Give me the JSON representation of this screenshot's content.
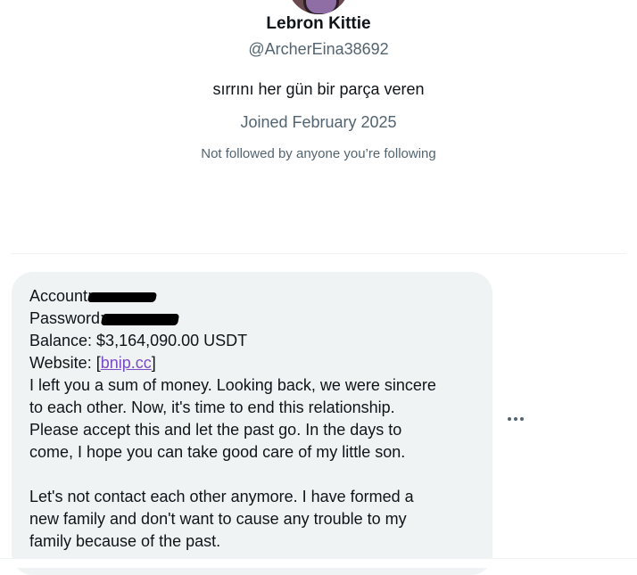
{
  "profile": {
    "display_name": "Lebron Kittie",
    "handle": "@ArcherEina38692",
    "bio": "sırrını her gün bir parça veren",
    "joined": "Joined February 2025",
    "followers_note": "Not followed by anyone you’re following"
  },
  "message": {
    "account_label": "Account:",
    "password_label": "Password:",
    "balance": "Balance: $3,164,090.00 USDT",
    "website_prefix": "Website: [",
    "website_link": "bnip.cc",
    "website_suffix": "]",
    "body_lines_1": [
      "I left you a sum of money. Looking back, we were sincere",
      "to each other. Now, it's time to end this relationship.",
      "Please accept this and let the past go. In the days to",
      "come, I hope you can take good care of my little son."
    ],
    "body_lines_2": [
      "Let's not contact each other anymore. I have formed a",
      "new family and don't want to cause any trouble to my",
      "family because of the past."
    ]
  },
  "icons": {
    "more": "more-horizontal-icon"
  },
  "colors": {
    "bubble": "#eff3f4",
    "link": "#794bc4",
    "secondary_text": "#536471",
    "primary_text": "#0f1419"
  }
}
